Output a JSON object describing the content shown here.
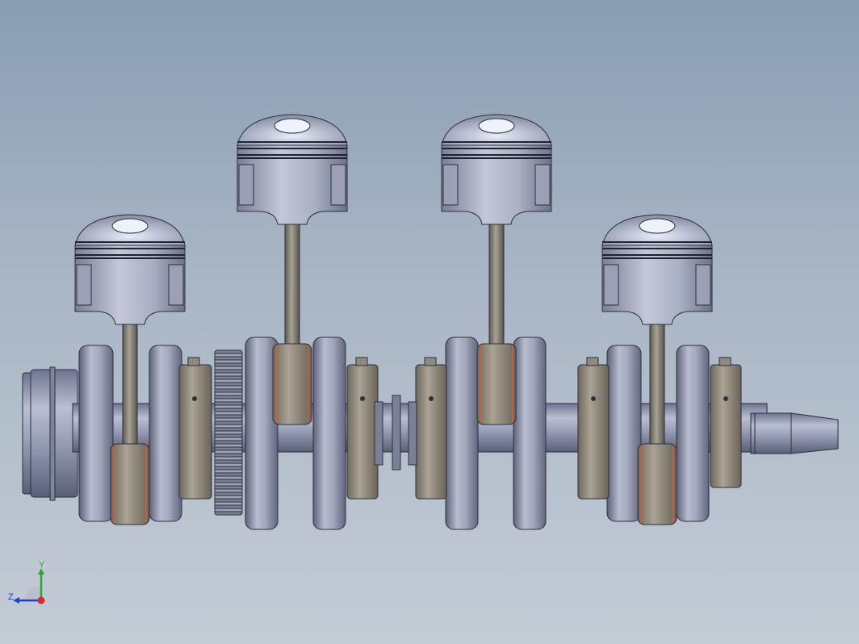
{
  "viewport": {
    "background_top": "#8a9db3",
    "background_bottom": "#c4ccd6"
  },
  "model": {
    "parts": [
      "crankshaft",
      "piston",
      "connecting-rod",
      "timing-gear"
    ],
    "piston_count": 4
  },
  "triad": {
    "y_label": "Y",
    "z_label": "Z",
    "y_color": "#2aa82a",
    "z_color": "#1e3fcf",
    "x_color": "#d42a2a"
  }
}
